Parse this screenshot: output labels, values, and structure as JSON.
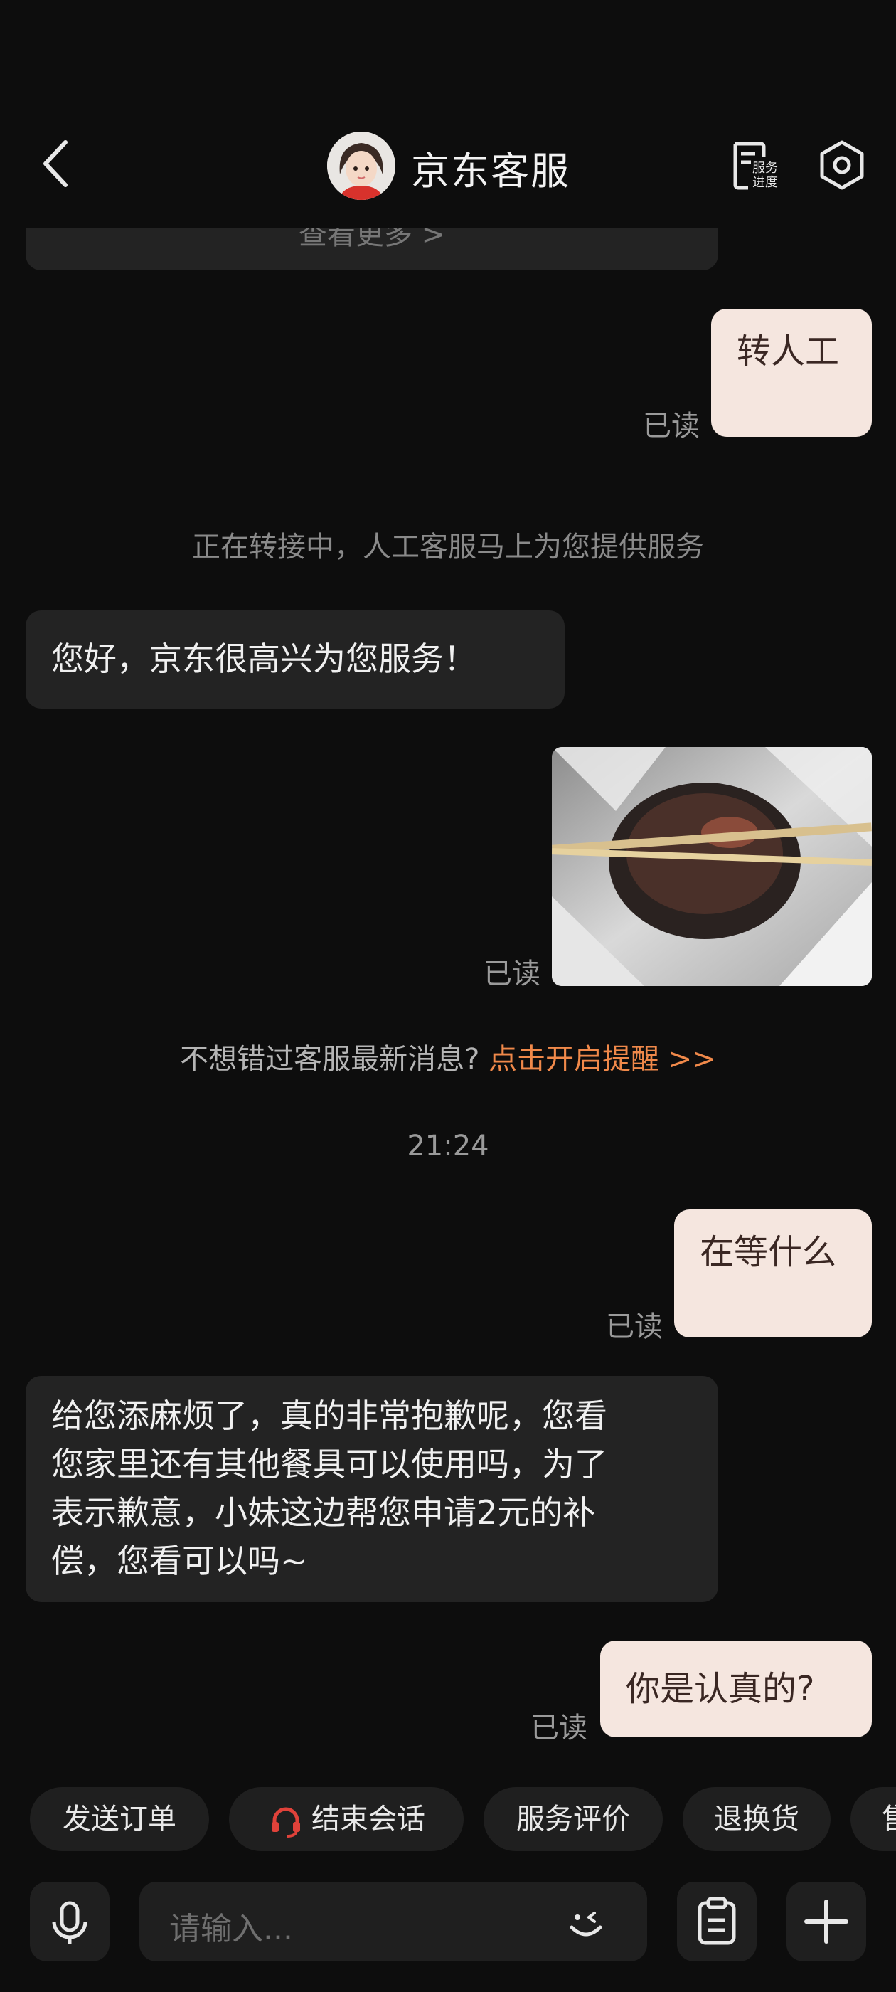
{
  "header": {
    "title": "京东客服",
    "service_progress_label": "服务进度"
  },
  "messages": {
    "prev_card_text": "查看更多 >",
    "m1_text": "转人工",
    "m1_read": "已读",
    "system_transfer": "正在转接中，人工客服马上为您提供服务",
    "m2_text": "您好，京东很高兴为您服务！",
    "m3_read": "已读",
    "remind_text": "不想错过客服最新消息?",
    "remind_link": "点击开启提醒 >>",
    "time": "21:24",
    "m4_text": "在等什么",
    "m4_read": "已读",
    "m5_lines": [
      "给您添麻烦了，真的非常抱歉呢，您看",
      "您家里还有其他餐具可以使用吗，为了",
      "表示歉意，小妹这边帮您申请2元的补",
      "偿，您看可以吗~"
    ],
    "m6_text": "你是认真的?",
    "m6_read": "已读"
  },
  "quick_actions": [
    "发送订单",
    "结束会话",
    "服务评价",
    "退换货",
    "售"
  ],
  "input": {
    "placeholder": "请输入..."
  },
  "colors": {
    "accent_orange": "#f0894a",
    "end_session_icon": "#e0423a",
    "outgoing_bubble": "#f5e6df",
    "incoming_bubble": "#232323"
  },
  "icons": [
    "back-icon",
    "avatar",
    "service-progress-icon",
    "settings-icon",
    "headset-icon",
    "microphone-icon",
    "emoji-icon",
    "clipboard-icon",
    "plus-icon"
  ]
}
